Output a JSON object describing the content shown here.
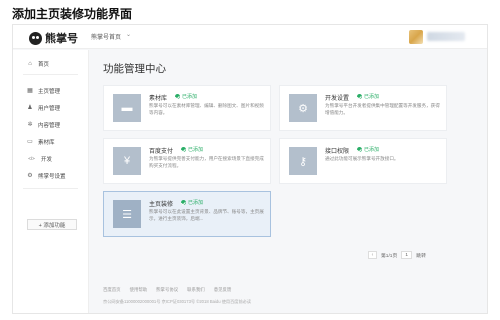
{
  "caption": "添加主页装修功能界面",
  "header": {
    "logo_text": "熊掌号",
    "account_name": "熊掌号首页",
    "account_caret": "⌄"
  },
  "sidebar": {
    "items": [
      {
        "label": "首页",
        "icon": "home-icon",
        "glyph": "⌂"
      },
      {
        "label": "主页管理",
        "icon": "grid-icon",
        "glyph": "▦"
      },
      {
        "label": "用户管理",
        "icon": "user-icon",
        "glyph": "♟"
      },
      {
        "label": "内容管理",
        "icon": "gear-icon",
        "glyph": "✲"
      },
      {
        "label": "素材库",
        "icon": "folder-icon",
        "glyph": "▭"
      },
      {
        "label": "开发",
        "icon": "code-icon",
        "glyph": "</>"
      },
      {
        "label": "熊掌号设置",
        "icon": "settings-icon",
        "glyph": "⚙"
      }
    ],
    "add_button": "+ 添加功能"
  },
  "main": {
    "title": "功能管理中心",
    "cards": [
      {
        "title": "素材库",
        "status": "已添加",
        "icon": "folder-icon",
        "glyph": "▬",
        "desc": "熊掌号可以在素材库管理、编辑、删除图文、图片和视频等内容。"
      },
      {
        "title": "开发设置",
        "status": "已添加",
        "icon": "gear-icon",
        "glyph": "⚙",
        "desc": "为熊掌号平台开发者提供集中管理配置等开发服务，获得增值能力。"
      },
      {
        "title": "百度支付",
        "status": "已添加",
        "icon": "yen-icon",
        "glyph": "¥",
        "desc": "为熊掌号提供完善支付能力，用户在搜索场景下直接完成购买支付流程。"
      },
      {
        "title": "接口权限",
        "status": "已添加",
        "icon": "key-icon",
        "glyph": "⚷",
        "desc": "通过此功能可展示熊掌号开放接口。"
      },
      {
        "title": "主页装修",
        "status": "已添加",
        "icon": "sliders-icon",
        "glyph": "☰",
        "desc": "熊掌号可以在此设置主页背景、品牌节、账号等，主页展示，进行主页装饰，后端..."
      }
    ]
  },
  "pager": {
    "prev": "‹",
    "page_label": "第1/1页",
    "page_input": "1",
    "next": "跳转"
  },
  "footer": {
    "links": [
      "百度首页",
      "使用帮助",
      "熊掌号协议",
      "联系我们",
      "意见反馈"
    ],
    "copyright": "京公网安备11000002000001号  京ICP证030173号  ©2018 Baidu  使用百度前必读"
  }
}
